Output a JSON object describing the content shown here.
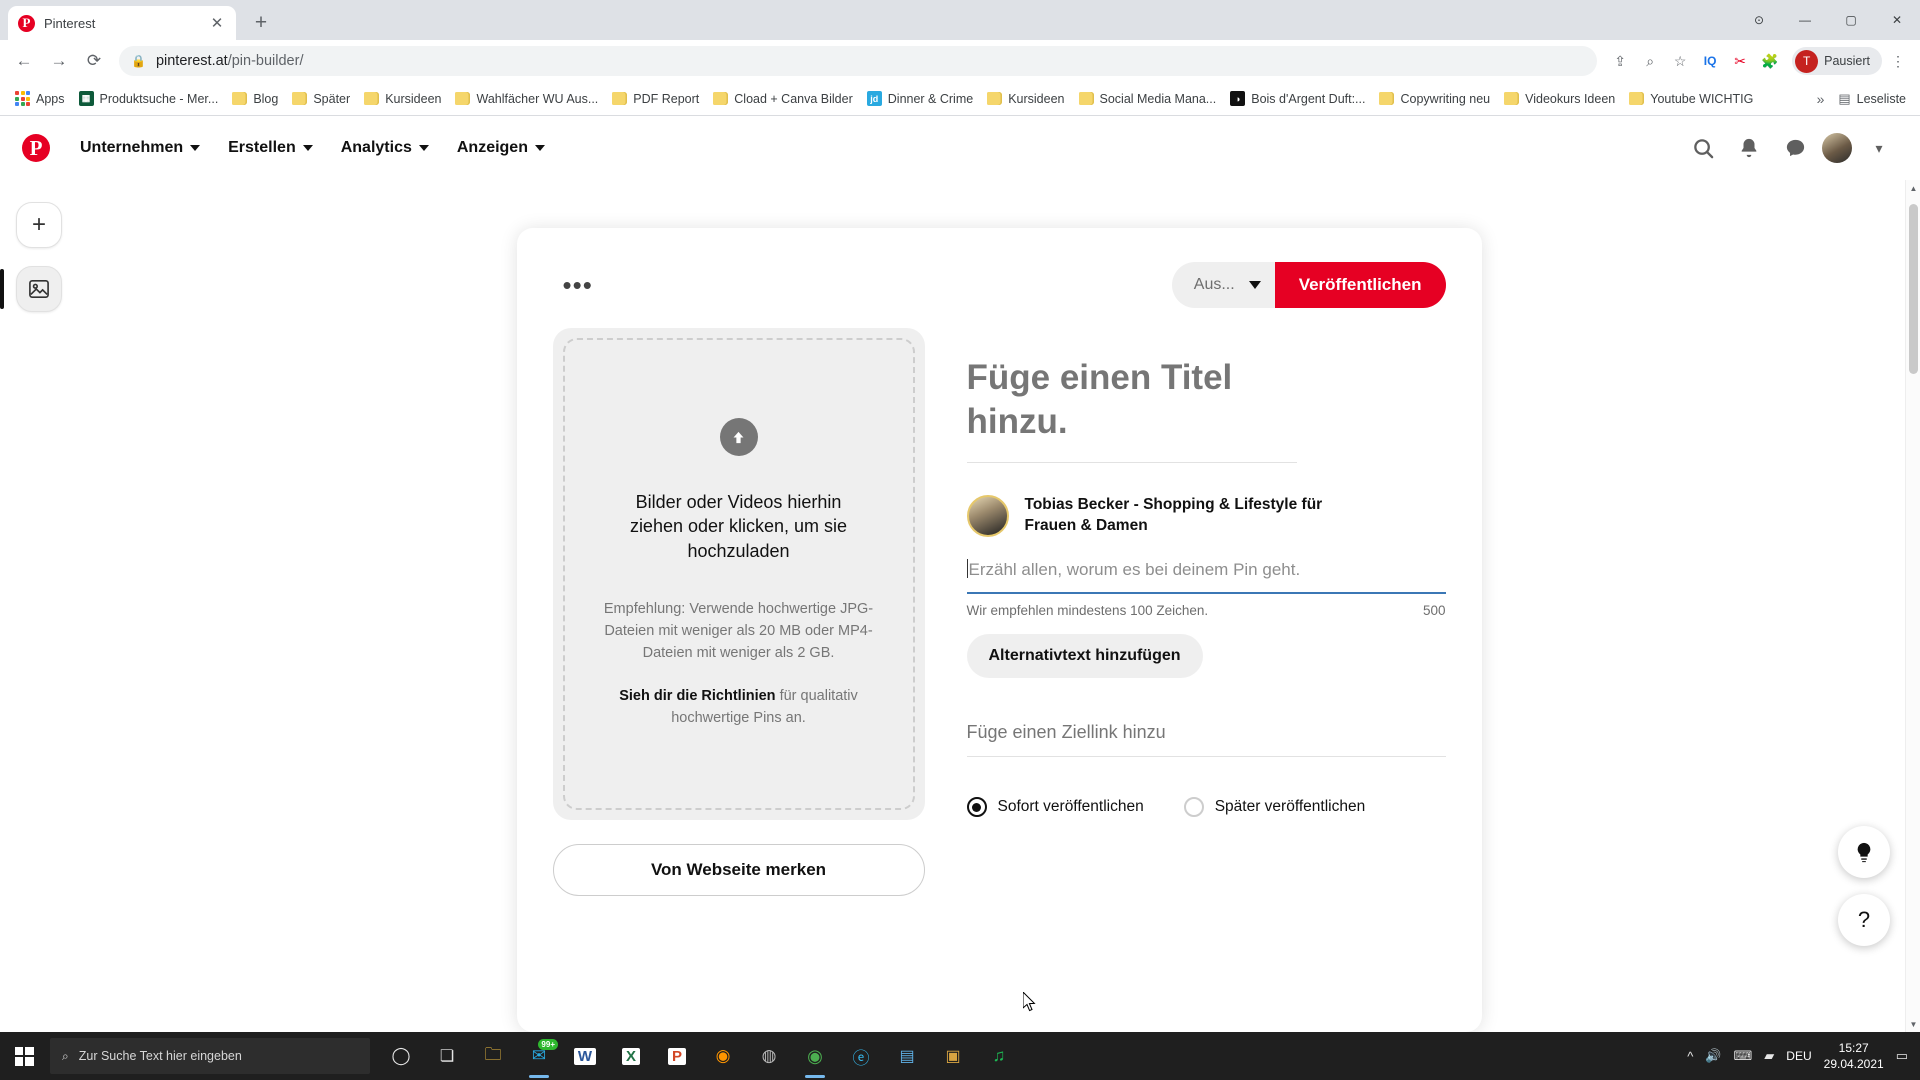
{
  "browser": {
    "tab": {
      "title": "Pinterest",
      "favicon_letter": "P",
      "close_icon": "✕"
    },
    "newtab_icon": "+",
    "window_controls": {
      "minimize": "—",
      "maximize": "▢",
      "close": "✕"
    },
    "nav": {
      "back_icon": "←",
      "forward_icon": "→",
      "reload_icon": "⟳"
    },
    "omnibox": {
      "lock_icon": "🔒",
      "domain": "pinterest.at",
      "path": "/pin-builder/"
    },
    "toolbar_icons": [
      "share-icon",
      "zoom-icon",
      "bookmark-star-icon",
      "iq-extension-icon",
      "keyword-extension-icon",
      "puzzle-extension-icon",
      "menu-icon"
    ],
    "profile": {
      "initial": "T",
      "label": "Pausiert"
    },
    "bookmarks": [
      {
        "label": "Apps",
        "icon": "apps-grid"
      },
      {
        "label": "Produktsuche - Mer...",
        "icon": "site-favicon",
        "color": "#0e5a3a"
      },
      {
        "label": "Blog",
        "icon": "folder"
      },
      {
        "label": "Später",
        "icon": "folder"
      },
      {
        "label": "Kursideen",
        "icon": "folder"
      },
      {
        "label": "Wahlfächer WU Aus...",
        "icon": "folder"
      },
      {
        "label": "PDF Report",
        "icon": "folder"
      },
      {
        "label": "Cload + Canva Bilder",
        "icon": "folder"
      },
      {
        "label": "Dinner & Crime",
        "icon": "site-favicon",
        "color": "#29a9e0",
        "text": "jd"
      },
      {
        "label": "Kursideen",
        "icon": "folder"
      },
      {
        "label": "Social Media Mana...",
        "icon": "folder"
      },
      {
        "label": "Bois d'Argent Duft:...",
        "icon": "site-favicon",
        "color": "#111111",
        "text": "◑"
      },
      {
        "label": "Copywriting neu",
        "icon": "folder"
      },
      {
        "label": "Videokurs Ideen",
        "icon": "folder"
      },
      {
        "label": "Youtube WICHTIG",
        "icon": "folder"
      }
    ],
    "bookmark_overflow_icon": "»",
    "reading_list": {
      "label": "Leseliste",
      "icon": "reading-list-icon"
    }
  },
  "pinterest": {
    "logo": "P",
    "nav": [
      {
        "label": "Unternehmen"
      },
      {
        "label": "Erstellen"
      },
      {
        "label": "Analytics"
      },
      {
        "label": "Anzeigen"
      }
    ],
    "header_icons": [
      "search-icon",
      "bell-icon",
      "chat-icon",
      "avatar",
      "chevron-down-icon"
    ],
    "rail": [
      {
        "name": "add-pin",
        "icon": "+"
      },
      {
        "name": "pin-builder",
        "icon": "▣"
      }
    ],
    "card": {
      "more_icon": "•••",
      "board_select": {
        "value": "Aus...",
        "chevron": "▾"
      },
      "publish_button": "Veröffentlichen",
      "dropzone": {
        "upload_icon": "⬆",
        "title": "Bilder oder Videos hierhin ziehen oder klicken, um sie hochzuladen",
        "note": "Empfehlung: Verwende hochwertige JPG-Dateien mit weniger als 20 MB oder MP4-Dateien mit weniger als 2 GB.",
        "guidelines_bold": "Sieh dir die Richtlinien",
        "guidelines_rest": " für qualitativ hochwertige Pins an."
      },
      "website_button": "Von Webseite merken",
      "title_placeholder": "Füge einen Titel hinzu.",
      "author": "Tobias Becker - Shopping & Lifestyle für Frauen & Damen",
      "description_placeholder": "Erzähl allen, worum es bei deinem Pin geht.",
      "description_hint": "Wir empfehlen mindestens 100 Zeichen.",
      "description_count": "500",
      "alt_text_button": "Alternativtext hinzufügen",
      "link_placeholder": "Füge einen Ziellink hinzu",
      "radios": [
        {
          "label": "Sofort veröffentlichen",
          "selected": true
        },
        {
          "label": "Später veröffentlichen",
          "selected": false
        }
      ]
    },
    "float_buttons": [
      {
        "name": "idea-bulb",
        "icon": "💡"
      },
      {
        "name": "help",
        "icon": "?"
      }
    ],
    "accent_color": "#e60023"
  },
  "taskbar": {
    "start_icon": "windows-logo",
    "search_placeholder": "Zur Suche Text hier eingeben",
    "search_icon": "🔍",
    "apps": [
      {
        "name": "cortana-icon",
        "glyph": "◯"
      },
      {
        "name": "task-view-icon",
        "glyph": "❏"
      },
      {
        "name": "file-explorer-icon",
        "glyph": "📁"
      },
      {
        "name": "mail-icon",
        "glyph": "✉",
        "badge": "99+"
      },
      {
        "name": "word-icon",
        "glyph": "W"
      },
      {
        "name": "excel-icon",
        "glyph": "X"
      },
      {
        "name": "powerpoint-icon",
        "glyph": "P"
      },
      {
        "name": "firefox-icon",
        "glyph": "◉"
      },
      {
        "name": "disc-icon",
        "glyph": "◍"
      },
      {
        "name": "chrome-icon",
        "glyph": "◉"
      },
      {
        "name": "edge-icon",
        "glyph": "ⓔ"
      },
      {
        "name": "store-icon",
        "glyph": "▤"
      },
      {
        "name": "photos-icon",
        "glyph": "▣"
      },
      {
        "name": "spotify-icon",
        "glyph": "♫"
      }
    ],
    "tray": {
      "overflow_icon": "^",
      "volume_icon": "🔊",
      "keyboard_icon": "⌨",
      "network_icon": "▰",
      "language": "DEU",
      "time": "15:27",
      "date": "29.04.2021",
      "notification_icon": "▭"
    }
  }
}
